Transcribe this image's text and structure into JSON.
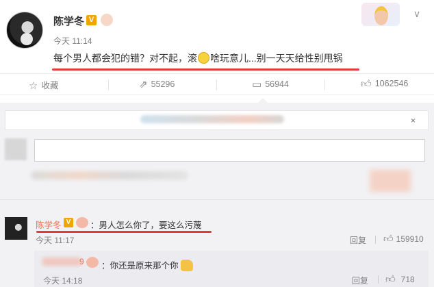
{
  "post": {
    "author": "陈学冬",
    "badge": "V",
    "time": "今天 11:14",
    "text_part1": "每个男人都会犯的错？对不起，滚",
    "emoji": "smile-emoji",
    "text_part2": "啥玩意儿...别一天天给性别甩锅",
    "more": "∨"
  },
  "actions": {
    "favorite": "收藏",
    "repost": "55296",
    "comment": "56944",
    "like": "1062546"
  },
  "notice": {
    "close": "×"
  },
  "comments": [
    {
      "author": "陈学冬",
      "badge": "V",
      "text": "：男人怎么你了，要这么污蔑",
      "time": "今天 11:17",
      "reply": "回复",
      "likes": "159910"
    }
  ],
  "sub_reply": {
    "author_visible": "9",
    "text": "：你还是原来那个你",
    "time": "今天 14:18",
    "reply": "回复",
    "likes": "718"
  },
  "colors": {
    "accent": "#eb7350",
    "highlight": "#e03c3c",
    "verified": "#f0a500"
  }
}
